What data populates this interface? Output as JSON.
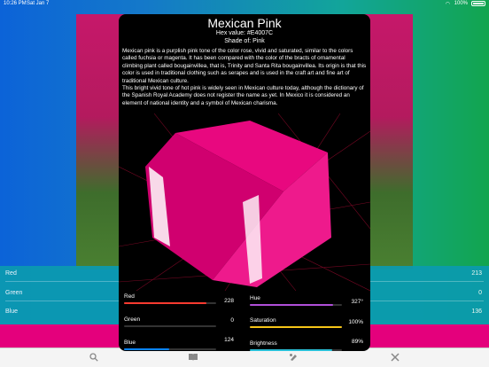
{
  "status": {
    "time": "10:26 PM",
    "date": "Sat Jan 7",
    "battery": "100%"
  },
  "background_panel": {
    "rows": [
      {
        "label": "Red",
        "value": "213"
      },
      {
        "label": "Green",
        "value": "0"
      },
      {
        "label": "Blue",
        "value": "136"
      }
    ]
  },
  "modal": {
    "title": "Mexican Pink",
    "hex": "Hex value: #E4007C",
    "shade": "Shade of: Pink",
    "description_p1": "Mexican pink is a purplish pink tone of the color rose, vivid and saturated, similar to the colors called fuchsia or magenta. It has been compared with the color of the bracts of ornamental climbing plant called bougainvillea, that is, Trinity and Santa Rita bougainvillea. Its origin is that this color is used in traditional clothing such as serapes and is used in the craft art and fine art of traditional Mexican culture.",
    "description_p2": "This bright vivid tone of hot pink is widely seen in Mexican culture today, although the dictionary of the Spanish Royal Academy does not register the name as yet. In Mexico it is considered an element of national identity and a symbol of Mexican charisma.",
    "color": "#E4007C",
    "properties_left": [
      {
        "label": "Red",
        "value": "228",
        "fraction": 0.894,
        "color": "#ff3b30"
      },
      {
        "label": "Green",
        "value": "0",
        "fraction": 0.0,
        "color": "#34c759"
      },
      {
        "label": "Blue",
        "value": "124",
        "fraction": 0.486,
        "color": "#0a84ff"
      }
    ],
    "properties_right": [
      {
        "label": "Hue",
        "value": "327°",
        "fraction": 0.908,
        "color": "#b04fd8"
      },
      {
        "label": "Saturation",
        "value": "100%",
        "fraction": 1.0,
        "color": "#f5c518"
      },
      {
        "label": "Brightness",
        "value": "89%",
        "fraction": 0.89,
        "color": "#2ac0d8"
      }
    ]
  },
  "tabs": [
    {
      "name": "search",
      "icon": "search-icon"
    },
    {
      "name": "library",
      "icon": "book-icon"
    },
    {
      "name": "palettes",
      "icon": "palette-icon"
    },
    {
      "name": "tools",
      "icon": "tools-icon"
    }
  ],
  "pink_bar_color": "#E4007C"
}
